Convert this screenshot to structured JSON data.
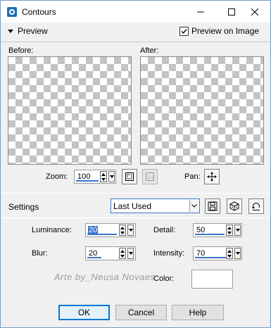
{
  "window": {
    "title": "Contours"
  },
  "preview": {
    "toggle_label": "Preview",
    "preview_on_image_label": "Preview on Image",
    "preview_on_image_checked": true,
    "before_label": "Before:",
    "after_label": "After:"
  },
  "zoom": {
    "label": "Zoom:",
    "value": "100",
    "pan_label": "Pan:"
  },
  "settings": {
    "label": "Settings",
    "preset": "Last Used"
  },
  "params": {
    "luminance": {
      "label": "Luminance:",
      "value": "20"
    },
    "detail": {
      "label": "Detail:",
      "value": "50"
    },
    "blur": {
      "label": "Blur:",
      "value": "20"
    },
    "intensity": {
      "label": "Intensity:",
      "value": "70"
    },
    "color": {
      "label": "Color:",
      "value": "#ffffff"
    }
  },
  "watermark": "Arte by_Neusa Novaes",
  "buttons": {
    "ok": "OK",
    "cancel": "Cancel",
    "help": "Help"
  }
}
